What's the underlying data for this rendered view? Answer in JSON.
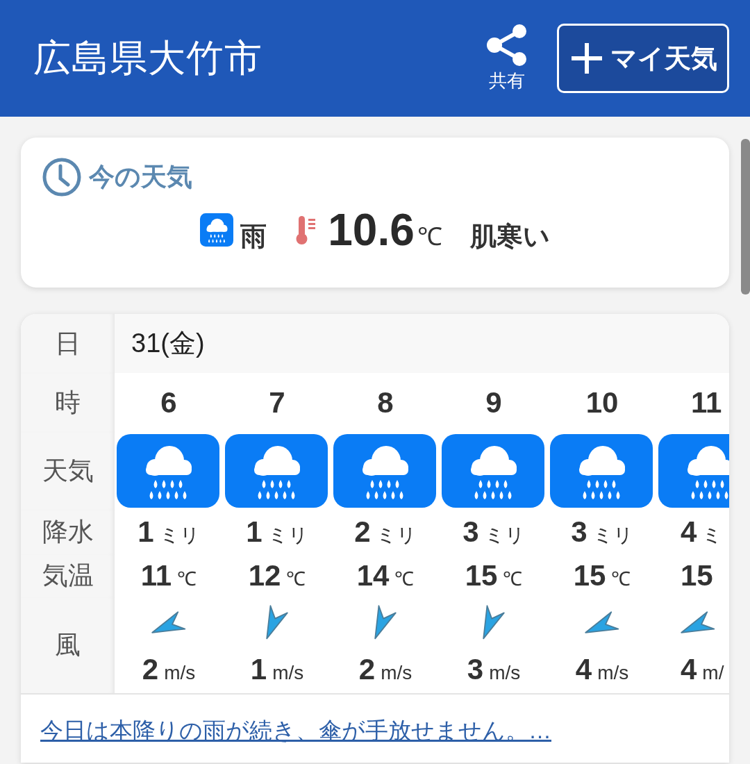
{
  "header": {
    "title": "広島県大竹市",
    "share_label": "共有",
    "my_weather_button": "マイ天気"
  },
  "current": {
    "heading": "今の天気",
    "condition": "雨",
    "temperature": "10.6",
    "temperature_unit": "℃",
    "feeling": "肌寒い"
  },
  "forecast": {
    "row_labels": [
      "日",
      "時",
      "天気",
      "降水",
      "気温",
      "風"
    ],
    "date": "31(金)",
    "hours": [
      {
        "hour": "6",
        "precip": "1",
        "precip_unit": "ミリ",
        "temp": "11",
        "temp_unit": "℃",
        "wind_arrow": {
          "kind": "wsw"
        },
        "wind": "2",
        "wind_unit": "m/s"
      },
      {
        "hour": "7",
        "precip": "1",
        "precip_unit": "ミリ",
        "temp": "12",
        "temp_unit": "℃",
        "wind_arrow": {
          "kind": "ssw"
        },
        "wind": "1",
        "wind_unit": "m/s"
      },
      {
        "hour": "8",
        "precip": "2",
        "precip_unit": "ミリ",
        "temp": "14",
        "temp_unit": "℃",
        "wind_arrow": {
          "kind": "ssw"
        },
        "wind": "2",
        "wind_unit": "m/s"
      },
      {
        "hour": "9",
        "precip": "3",
        "precip_unit": "ミリ",
        "temp": "15",
        "temp_unit": "℃",
        "wind_arrow": {
          "kind": "ssw"
        },
        "wind": "3",
        "wind_unit": "m/s"
      },
      {
        "hour": "10",
        "precip": "3",
        "precip_unit": "ミリ",
        "temp": "15",
        "temp_unit": "℃",
        "wind_arrow": {
          "kind": "wsw"
        },
        "wind": "4",
        "wind_unit": "m/s"
      },
      {
        "hour": "11",
        "precip": "4",
        "precip_unit": "ミ",
        "temp": "15",
        "wind_arrow": {
          "kind": "wsw"
        },
        "wind": "4",
        "wind_unit": "m/"
      }
    ]
  },
  "summary_link": "今日は本降りの雨が続き、傘が手放せません。…"
}
